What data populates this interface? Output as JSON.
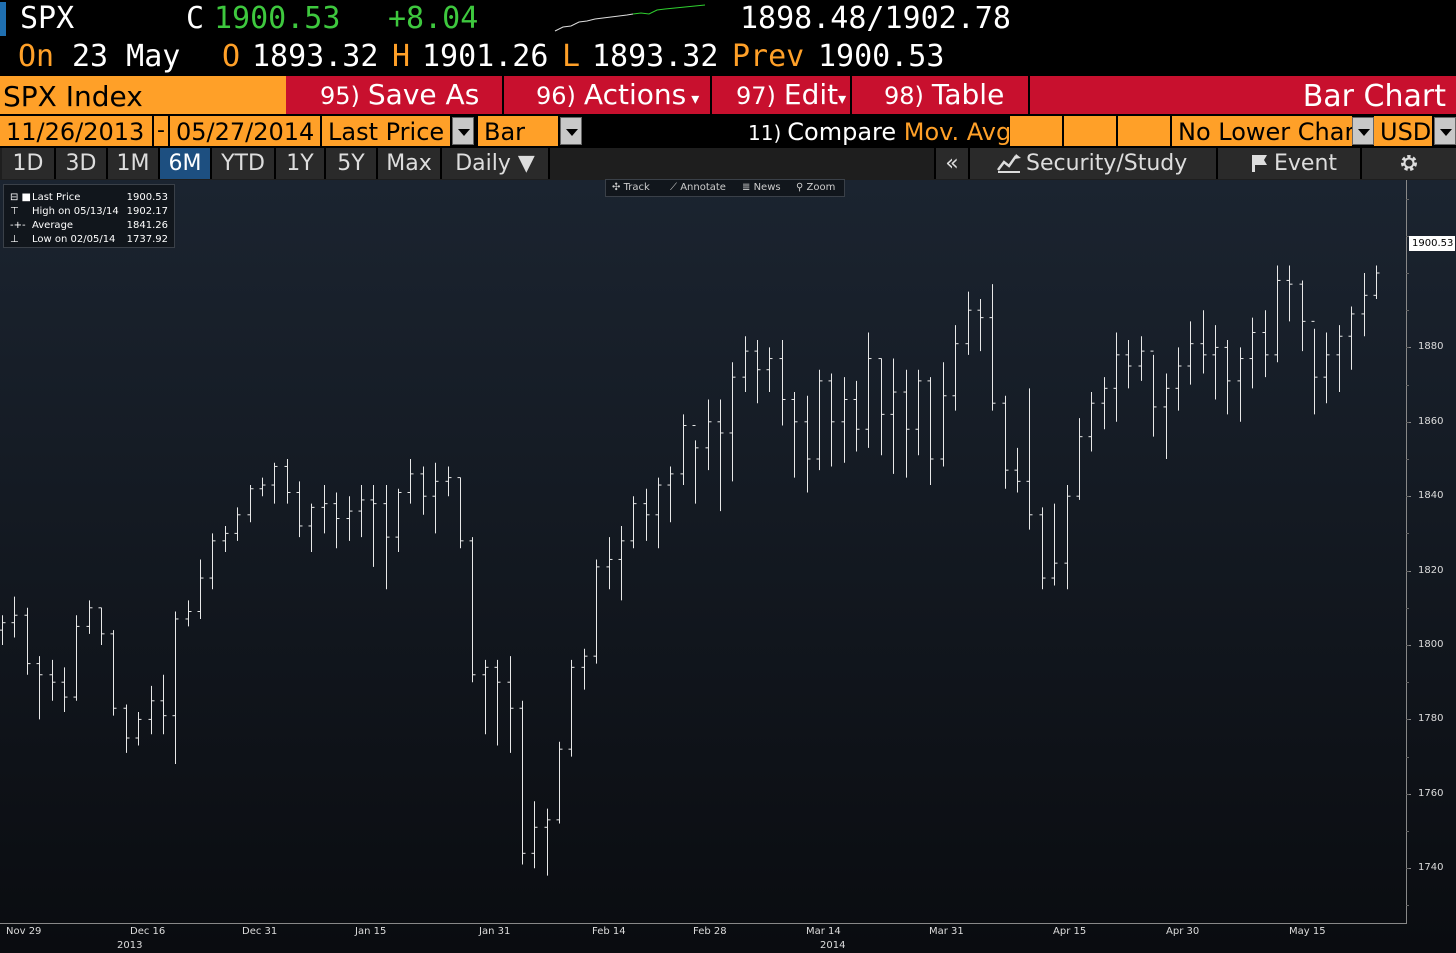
{
  "header": {
    "symbol": "SPX",
    "close_label": "C",
    "close": "1900.53",
    "change": "+8.04",
    "bid_ask": "1898.48/1902.78",
    "on_label": "On",
    "date": "23 May",
    "open_label": "O",
    "open": "1893.32",
    "high_label": "H",
    "high": "1901.26",
    "low_label": "L",
    "low": "1893.32",
    "prev_label": "Prev",
    "prev": "1900.53"
  },
  "menu": {
    "title": "SPX Index",
    "save_num": "95)",
    "save": "Save As",
    "actions_num": "96)",
    "actions": "Actions",
    "edit_num": "97)",
    "edit": "Edit",
    "table_num": "98)",
    "table": "Table",
    "chart_type": "Bar Chart"
  },
  "params": {
    "start_date": "11/26/2013",
    "dash": "-",
    "end_date": "05/27/2014",
    "field": "Last Price",
    "style": "Bar",
    "compare_num": "11)",
    "compare": "Compare",
    "mov_avgs": "Mov. Avgs",
    "lower_chart": "No Lower Chart",
    "currency": "USD"
  },
  "periods": {
    "items": [
      "1D",
      "3D",
      "1M",
      "6M",
      "YTD",
      "1Y",
      "5Y",
      "Max"
    ],
    "active": "6M",
    "frequency": "Daily ▼",
    "collapse": "«",
    "security_study": "Security/Study",
    "event": "Event",
    "settings_icon": "gear-icon"
  },
  "legend": {
    "last_label": "Last Price",
    "last": "1900.53",
    "high_label": "High on 05/13/14",
    "high": "1902.17",
    "avg_label": "Average",
    "avg": "1841.26",
    "low_label": "Low on 02/05/14",
    "low": "1737.92"
  },
  "chart_tools": {
    "track": "Track",
    "annotate": "Annotate",
    "news": "News",
    "zoom": "Zoom"
  },
  "chart_data": {
    "type": "bar",
    "title": "",
    "ylim": [
      1725,
      1925
    ],
    "yticks": [
      "1880",
      "1860",
      "1840",
      "1820",
      "1800",
      "1780",
      "1760",
      "1740"
    ],
    "last_value_label": "1900.53",
    "xticks": [
      "Nov 29",
      "Dec 16",
      "Dec 31",
      "Jan 15",
      "Jan 31",
      "Feb 14",
      "Feb 28",
      "Mar 14",
      "Mar 31",
      "Apr 15",
      "Apr 30",
      "May 15"
    ],
    "year_labels": [
      "2013",
      "2014"
    ],
    "series": [
      {
        "values": [
          [
            1804,
            1808,
            1800,
            1806
          ],
          [
            1806,
            1813,
            1802,
            1808
          ],
          [
            1808,
            1810,
            1792,
            1795
          ],
          [
            1795,
            1797,
            1780,
            1792
          ],
          [
            1792,
            1796,
            1785,
            1790
          ],
          [
            1790,
            1794,
            1782,
            1786
          ],
          [
            1786,
            1808,
            1785,
            1805
          ],
          [
            1805,
            1812,
            1803,
            1810
          ],
          [
            1810,
            1810,
            1800,
            1803
          ],
          [
            1803,
            1804,
            1781,
            1783
          ],
          [
            1783,
            1784,
            1771,
            1775
          ],
          [
            1775,
            1782,
            1773,
            1780
          ],
          [
            1780,
            1789,
            1776,
            1785
          ],
          [
            1785,
            1792,
            1776,
            1781
          ],
          [
            1781,
            1809,
            1768,
            1807
          ],
          [
            1807,
            1812,
            1805,
            1809
          ],
          [
            1809,
            1823,
            1807,
            1818
          ],
          [
            1818,
            1830,
            1815,
            1828
          ],
          [
            1828,
            1832,
            1825,
            1830
          ],
          [
            1830,
            1837,
            1828,
            1835
          ],
          [
            1835,
            1843,
            1833,
            1842
          ],
          [
            1842,
            1845,
            1840,
            1843
          ],
          [
            1843,
            1849,
            1838,
            1848
          ],
          [
            1848,
            1850,
            1838,
            1841
          ],
          [
            1841,
            1844,
            1829,
            1832
          ],
          [
            1832,
            1838,
            1825,
            1837
          ],
          [
            1837,
            1843,
            1830,
            1838
          ],
          [
            1838,
            1841,
            1826,
            1834
          ],
          [
            1834,
            1840,
            1828,
            1836
          ],
          [
            1836,
            1843,
            1829,
            1839
          ],
          [
            1839,
            1843,
            1821,
            1838
          ],
          [
            1838,
            1843,
            1815,
            1829
          ],
          [
            1829,
            1842,
            1825,
            1841
          ],
          [
            1841,
            1850,
            1838,
            1846
          ],
          [
            1846,
            1848,
            1835,
            1840
          ],
          [
            1840,
            1849,
            1830,
            1844
          ],
          [
            1844,
            1848,
            1840,
            1845
          ],
          [
            1845,
            1845,
            1826,
            1828
          ],
          [
            1828,
            1829,
            1790,
            1792
          ],
          [
            1792,
            1796,
            1776,
            1794
          ],
          [
            1794,
            1796,
            1773,
            1790
          ],
          [
            1790,
            1797,
            1771,
            1783
          ],
          [
            1783,
            1785,
            1741,
            1744
          ],
          [
            1744,
            1758,
            1740,
            1751
          ],
          [
            1751,
            1756,
            1738,
            1753
          ],
          [
            1753,
            1774,
            1752,
            1772
          ],
          [
            1772,
            1796,
            1770,
            1794
          ],
          [
            1794,
            1799,
            1788,
            1797
          ],
          [
            1797,
            1823,
            1795,
            1821
          ],
          [
            1821,
            1829,
            1815,
            1823
          ],
          [
            1823,
            1832,
            1812,
            1828
          ],
          [
            1828,
            1840,
            1826,
            1838
          ],
          [
            1838,
            1842,
            1828,
            1835
          ],
          [
            1835,
            1845,
            1826,
            1843
          ],
          [
            1843,
            1848,
            1833,
            1846
          ],
          [
            1846,
            1862,
            1843,
            1859
          ],
          [
            1859,
            1855,
            1838,
            1853
          ],
          [
            1853,
            1866,
            1847,
            1860
          ],
          [
            1860,
            1866,
            1836,
            1857
          ],
          [
            1857,
            1876,
            1844,
            1872
          ],
          [
            1872,
            1883,
            1868,
            1879
          ],
          [
            1879,
            1882,
            1865,
            1874
          ],
          [
            1874,
            1880,
            1868,
            1877
          ],
          [
            1877,
            1882,
            1859,
            1866
          ],
          [
            1866,
            1868,
            1845,
            1860
          ],
          [
            1860,
            1867,
            1841,
            1850
          ],
          [
            1850,
            1874,
            1847,
            1871
          ],
          [
            1871,
            1873,
            1848,
            1860
          ],
          [
            1860,
            1872,
            1849,
            1866
          ],
          [
            1866,
            1871,
            1852,
            1858
          ],
          [
            1858,
            1884,
            1853,
            1877
          ],
          [
            1877,
            1877,
            1851,
            1862
          ],
          [
            1862,
            1877,
            1846,
            1868
          ],
          [
            1868,
            1874,
            1845,
            1858
          ],
          [
            1858,
            1874,
            1851,
            1871
          ],
          [
            1871,
            1872,
            1843,
            1850
          ],
          [
            1850,
            1876,
            1848,
            1867
          ],
          [
            1867,
            1886,
            1863,
            1881
          ],
          [
            1881,
            1895,
            1878,
            1890
          ],
          [
            1890,
            1893,
            1879,
            1888
          ],
          [
            1888,
            1897,
            1863,
            1865
          ],
          [
            1865,
            1867,
            1842,
            1847
          ],
          [
            1847,
            1853,
            1841,
            1844
          ],
          [
            1844,
            1869,
            1831,
            1835
          ],
          [
            1835,
            1837,
            1815,
            1818
          ],
          [
            1818,
            1838,
            1816,
            1822
          ],
          [
            1822,
            1843,
            1815,
            1840
          ],
          [
            1840,
            1861,
            1839,
            1856
          ],
          [
            1856,
            1868,
            1852,
            1865
          ],
          [
            1865,
            1872,
            1858,
            1869
          ],
          [
            1869,
            1884,
            1860,
            1878
          ],
          [
            1878,
            1882,
            1869,
            1875
          ],
          [
            1875,
            1883,
            1871,
            1879
          ],
          [
            1879,
            1878,
            1856,
            1864
          ],
          [
            1864,
            1873,
            1850,
            1869
          ],
          [
            1869,
            1880,
            1863,
            1875
          ],
          [
            1875,
            1887,
            1870,
            1881
          ],
          [
            1881,
            1890,
            1873,
            1878
          ],
          [
            1878,
            1886,
            1866,
            1880
          ],
          [
            1880,
            1882,
            1862,
            1871
          ],
          [
            1871,
            1880,
            1860,
            1877
          ],
          [
            1877,
            1888,
            1869,
            1884
          ],
          [
            1884,
            1890,
            1872,
            1878
          ],
          [
            1878,
            1902,
            1876,
            1898
          ],
          [
            1898,
            1902,
            1887,
            1897
          ],
          [
            1897,
            1898,
            1879,
            1887
          ],
          [
            1887,
            1885,
            1862,
            1872
          ],
          [
            1872,
            1884,
            1865,
            1878
          ],
          [
            1878,
            1886,
            1868,
            1883
          ],
          [
            1883,
            1891,
            1874,
            1889
          ],
          [
            1889,
            1900,
            1883,
            1894
          ],
          [
            1894,
            1902,
            1893,
            1900
          ]
        ]
      }
    ]
  }
}
